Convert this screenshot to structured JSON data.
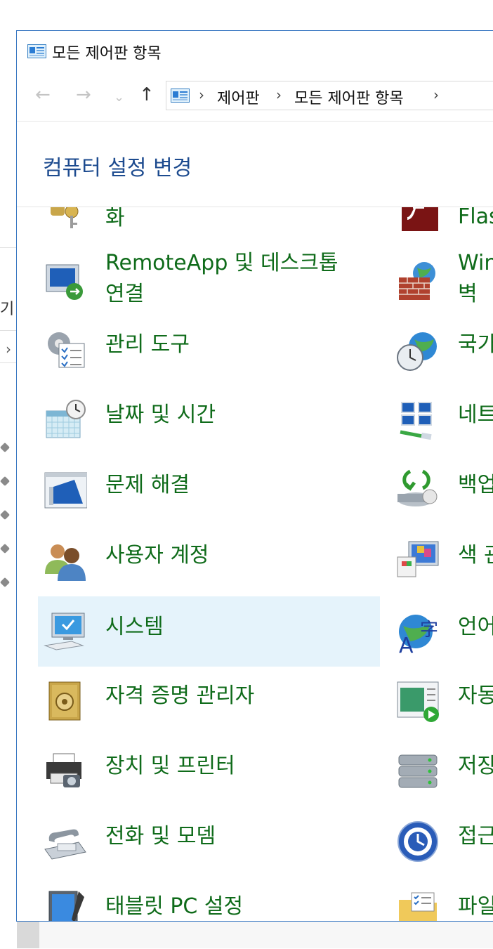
{
  "window": {
    "title": "모든 제어판 항목"
  },
  "address": {
    "crumb1": "제어판",
    "crumb2": "모든 제어판 항목",
    "sep": "›"
  },
  "nav": {
    "back": "←",
    "forward": "→",
    "recent": "⌄",
    "up": "↑"
  },
  "header": {
    "title": "컴퓨터 설정 변경"
  },
  "background": {
    "text": "기",
    "chevron": "›"
  },
  "items_left": [
    {
      "label": "화"
    },
    {
      "label": "RemoteApp 및 데스크톱",
      "label2": "연결"
    },
    {
      "label": "관리 도구"
    },
    {
      "label": "날짜 및 시간"
    },
    {
      "label": "문제 해결"
    },
    {
      "label": "사용자 계정"
    },
    {
      "label": "시스템"
    },
    {
      "label": "자격 증명 관리자"
    },
    {
      "label": "장치 및 프린터"
    },
    {
      "label": "전화 및 모뎀"
    },
    {
      "label": "태블릿 PC 설정"
    }
  ],
  "items_right": [
    {
      "label": "Flas"
    },
    {
      "label": "Win",
      "label2": "벽"
    },
    {
      "label": "국가"
    },
    {
      "label": "네트"
    },
    {
      "label": "백업"
    },
    {
      "label": "색 관"
    },
    {
      "label": "언어"
    },
    {
      "label": "자동"
    },
    {
      "label": "저장"
    },
    {
      "label": "접근"
    },
    {
      "label": "파일"
    }
  ],
  "colors": {
    "link_green": "#0f6b1a",
    "header_blue": "#1d4b8f",
    "selection": "#e5f3fb",
    "window_border": "#3a78c2"
  }
}
